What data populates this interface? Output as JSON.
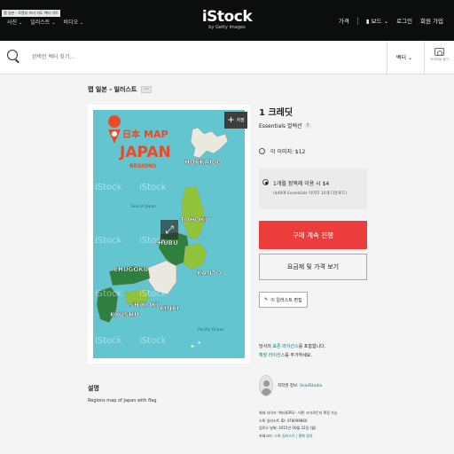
{
  "header": {
    "tooltip": "맵 일본 - 로열티 프리 지도 벡터 아트",
    "nav": [
      {
        "label": "사진"
      },
      {
        "label": "일러스트"
      },
      {
        "label": "비디오"
      }
    ],
    "brand": "iStock",
    "brand_sub": "by Getty Images",
    "price_link": "가격",
    "boards": "보드",
    "login": "로그인",
    "signup": "회원 가입"
  },
  "search": {
    "placeholder": "완벽한 벡터 찾기...",
    "filter": "벡터",
    "camera_label": "이미지로 찾기"
  },
  "breadcrumb": {
    "title": "맵 일본 - 일러스트",
    "more": "···"
  },
  "image": {
    "save_label": "저장",
    "map_title_kanji": "日本",
    "map_title_map": "MAP",
    "map_title_japan": "JAPAN",
    "map_title_regions": "REGIONS",
    "sea_label": "Sea of Japan",
    "ocean_label": "Pacific Ocean",
    "regions": [
      "HOKKAIDO",
      "TOHOKU",
      "CHUBU",
      "KANTO",
      "CHUGOKU",
      "SHIKOKU",
      "KINKI",
      "KYUSHU"
    ],
    "watermark": "iStock"
  },
  "description": {
    "heading": "설명",
    "text": "Regions map of Japan with flag"
  },
  "purchase": {
    "credits": "1 크레딧",
    "collection": "Essentials 컬렉션",
    "collection_help": "?",
    "option1": "이 이미지: $12",
    "option2_main": "1개월 정액제 이용 시 $4",
    "option2_sub": "($40에 Essentials 이미지 10개 다운로드)",
    "buy": "구매 계속 진행",
    "plans": "요금제 및 가격 보기",
    "edit": "이 일러스트 편집"
  },
  "license": {
    "line1_pre": "당사의 ",
    "line1_link": "표준 라이선스",
    "line1_post": "를 포함합니다.",
    "line2_link": "확장 라이선스",
    "line2_post": "를 추가하세요."
  },
  "contributor": {
    "label": "저작권 정보: ",
    "name": "SnailStudio"
  },
  "meta": {
    "size": "최대 사이즈: 벡터(EPS) - 어떤 크기로든지 확장 가능",
    "id": "스톡 일러스트 ID: 478099860",
    "date": "업로드 날짜: 2015년 06월 22일 (월)",
    "category_pre": "카테고리: ",
    "category_links": "스톡 일러스트 | 평화 정치"
  },
  "colors": {
    "accent_red": "#ec3c3c",
    "teal": "#0a7c6c",
    "map_sea": "#63c5cf"
  }
}
